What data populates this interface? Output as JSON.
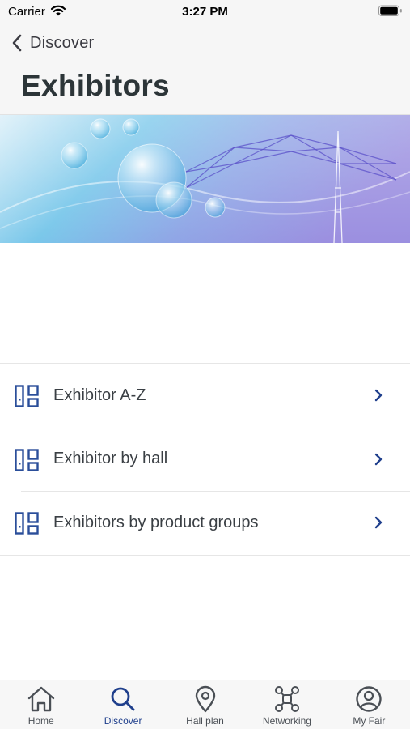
{
  "status_bar": {
    "carrier": "Carrier",
    "time": "3:27 PM"
  },
  "nav": {
    "back_label": "Discover",
    "title": "Exhibitors"
  },
  "menu": {
    "items": [
      {
        "label": "Exhibitor A-Z",
        "icon": "grid-list-icon"
      },
      {
        "label": "Exhibitor by hall",
        "icon": "grid-list-icon"
      },
      {
        "label": "Exhibitors by product groups",
        "icon": "grid-list-icon"
      }
    ]
  },
  "tab_bar": {
    "active": "Discover",
    "tabs": [
      {
        "label": "Home",
        "icon": "home-icon"
      },
      {
        "label": "Discover",
        "icon": "search-icon"
      },
      {
        "label": "Hall plan",
        "icon": "location-pin-icon"
      },
      {
        "label": "Networking",
        "icon": "network-icon"
      },
      {
        "label": "My Fair",
        "icon": "profile-icon"
      }
    ]
  },
  "colors": {
    "accent": "#1f3f8c",
    "icon_blue": "#2a4e9a",
    "header_bg": "#f6f6f6"
  }
}
